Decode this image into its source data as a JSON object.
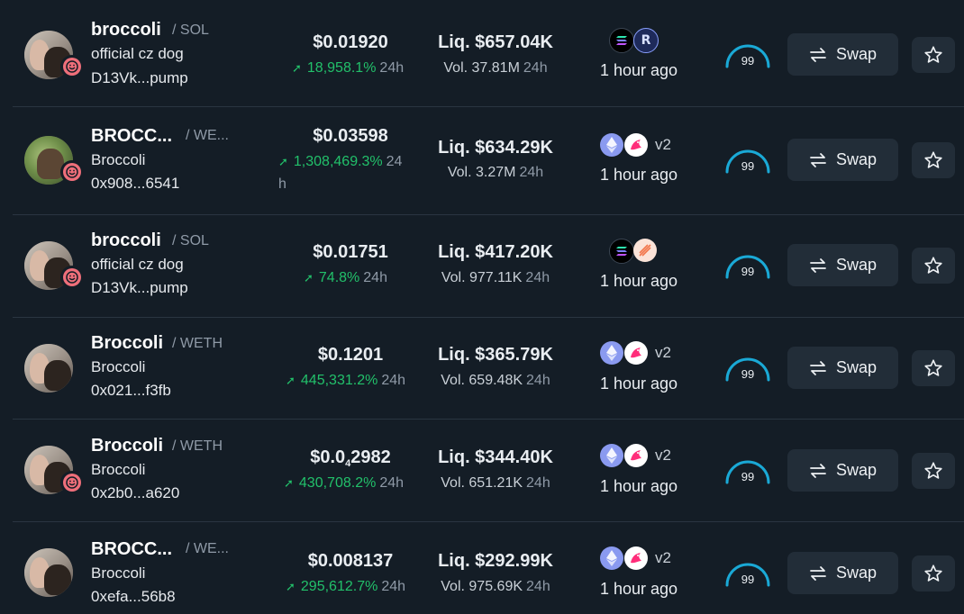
{
  "rows": [
    {
      "name": "broccoli",
      "pair": "/ SOL",
      "subtitle": "official cz dog",
      "address": "D13Vk...pump",
      "price": "$0.01920",
      "change": "18,958.1%",
      "change_period": "24h",
      "liquidity": "Liq. $657.04K",
      "volume": "Vol. 37.81M",
      "volume_period": "24h",
      "chains": [
        "solana-icon",
        "raydium-icon"
      ],
      "version": "",
      "time": "1 hour ago",
      "score": "99",
      "swap_label": "Swap"
    },
    {
      "name": "BROCC...",
      "pair": "/ WE...",
      "subtitle": "Broccoli",
      "address": "0x908...6541",
      "price": "$0.03598",
      "change": "1,308,469.3%",
      "change_period": "24",
      "change_period_wrap": "h",
      "liquidity": "Liq. $634.29K",
      "volume": "Vol. 3.27M",
      "volume_period": "24h",
      "chains": [
        "ethereum-icon",
        "uniswap-icon"
      ],
      "version": "v2",
      "time": "1 hour ago",
      "score": "99",
      "swap_label": "Swap"
    },
    {
      "name": "broccoli",
      "pair": "/ SOL",
      "subtitle": "official cz dog",
      "address": "D13Vk...pump",
      "price": "$0.01751",
      "change": "74.8%",
      "change_period": "24h",
      "liquidity": "Liq. $417.20K",
      "volume": "Vol. 977.11K",
      "volume_period": "24h",
      "chains": [
        "solana-icon",
        "meteora-icon"
      ],
      "version": "",
      "time": "1 hour ago",
      "score": "99",
      "swap_label": "Swap"
    },
    {
      "name": "Broccoli",
      "pair": "/ WETH",
      "subtitle": "Broccoli",
      "address": "0x021...f3fb",
      "price": "$0.1201",
      "change": "445,331.2%",
      "change_period": "24h",
      "liquidity": "Liq. $365.79K",
      "volume": "Vol. 659.48K",
      "volume_period": "24h",
      "chains": [
        "ethereum-icon",
        "uniswap-icon"
      ],
      "version": "v2",
      "time": "1 hour ago",
      "score": "99",
      "swap_label": "Swap"
    },
    {
      "name": "Broccoli",
      "pair": "/ WETH",
      "subtitle": "Broccoli",
      "address": "0x2b0...a620",
      "price_main": "$0.0",
      "price_sub": "4",
      "price_rest": "2982",
      "change": "430,708.2%",
      "change_period": "24h",
      "liquidity": "Liq. $344.40K",
      "volume": "Vol. 651.21K",
      "volume_period": "24h",
      "chains": [
        "ethereum-icon",
        "uniswap-icon"
      ],
      "version": "v2",
      "time": "1 hour ago",
      "score": "99",
      "swap_label": "Swap"
    },
    {
      "name": "BROCC...",
      "pair": "/ WE...",
      "subtitle": "Broccoli",
      "address": "0xefa...56b8",
      "price": "$0.008137",
      "change": "295,612.7%",
      "change_period": "24h",
      "liquidity": "Liq. $292.99K",
      "volume": "Vol. 975.69K",
      "volume_period": "24h",
      "chains": [
        "ethereum-icon",
        "uniswap-icon"
      ],
      "version": "v2",
      "time": "1 hour ago",
      "score": "99",
      "swap_label": "Swap"
    }
  ],
  "colors": {
    "background": "#141d26",
    "positive": "#22c06a",
    "muted": "#8f9aa7",
    "button": "#222d38",
    "gauge": "#1aa9d6",
    "badge": "#ef6f7a"
  }
}
